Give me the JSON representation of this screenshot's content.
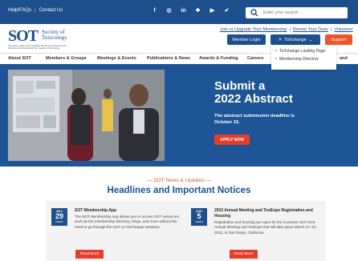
{
  "topbar": {
    "links": [
      "Help/FAQs",
      "Contact Us"
    ],
    "social_icons": [
      "facebook-icon",
      "instagram-icon",
      "linkedin-icon",
      "podcast-icon",
      "youtube-icon",
      "twitter-icon"
    ],
    "search_placeholder": "Enter your search"
  },
  "logo": {
    "abbr": "SOT",
    "name_line1": "Society of",
    "name_line2": "Toxicology",
    "tagline": "Creating a Safer and Healthier World by Advancing the Science and Increasing the Impact of Toxicology"
  },
  "header": {
    "links": [
      "Join or Upgrade Your Membership",
      "Renew Your Dues",
      "Volunteer"
    ],
    "member_login": "Member Login",
    "toxchange": "ToXchange",
    "support": "Support"
  },
  "dropdown": {
    "items": [
      "ToXchange Landing Page",
      "Membership Directory"
    ]
  },
  "nav": {
    "items": [
      "About SOT",
      "Members & Groups",
      "Meetings & Events",
      "Publications & News",
      "Awards & Funding",
      "Careers",
      "and"
    ]
  },
  "hero": {
    "title_line1": "Submit a",
    "title_line2": "2022 Abstract",
    "subtitle": "The abstract submission deadline is October 15.",
    "button": "APPLY NOW"
  },
  "news": {
    "kicker": "SOT News & Updates",
    "headline": "Headlines and Important Notices",
    "cards": [
      {
        "month": "JULY",
        "day": "29",
        "label": "NEWS",
        "title": "SOT Membership App",
        "body": "The SOT Membership App allows you to access SOT resources, such as the membership directory, blogs, and more without the need to go through the SOT or ToXchange websites.",
        "button": "Read More"
      },
      {
        "month": "AUG",
        "day": "5",
        "label": "NEWS",
        "title": "2022 Annual Meeting and ToxExpo Registration and Housing",
        "body": "Registration and housing are open for the in-person SOT 61st Annual Meeting and ToxExpo that will take place March 27–31, 2022, in San Diego, California.",
        "button": "Read More"
      }
    ]
  },
  "colors": {
    "brand_blue": "#1d4f8c",
    "accent_orange": "#e8562a",
    "apply_red": "#e33d2b"
  }
}
